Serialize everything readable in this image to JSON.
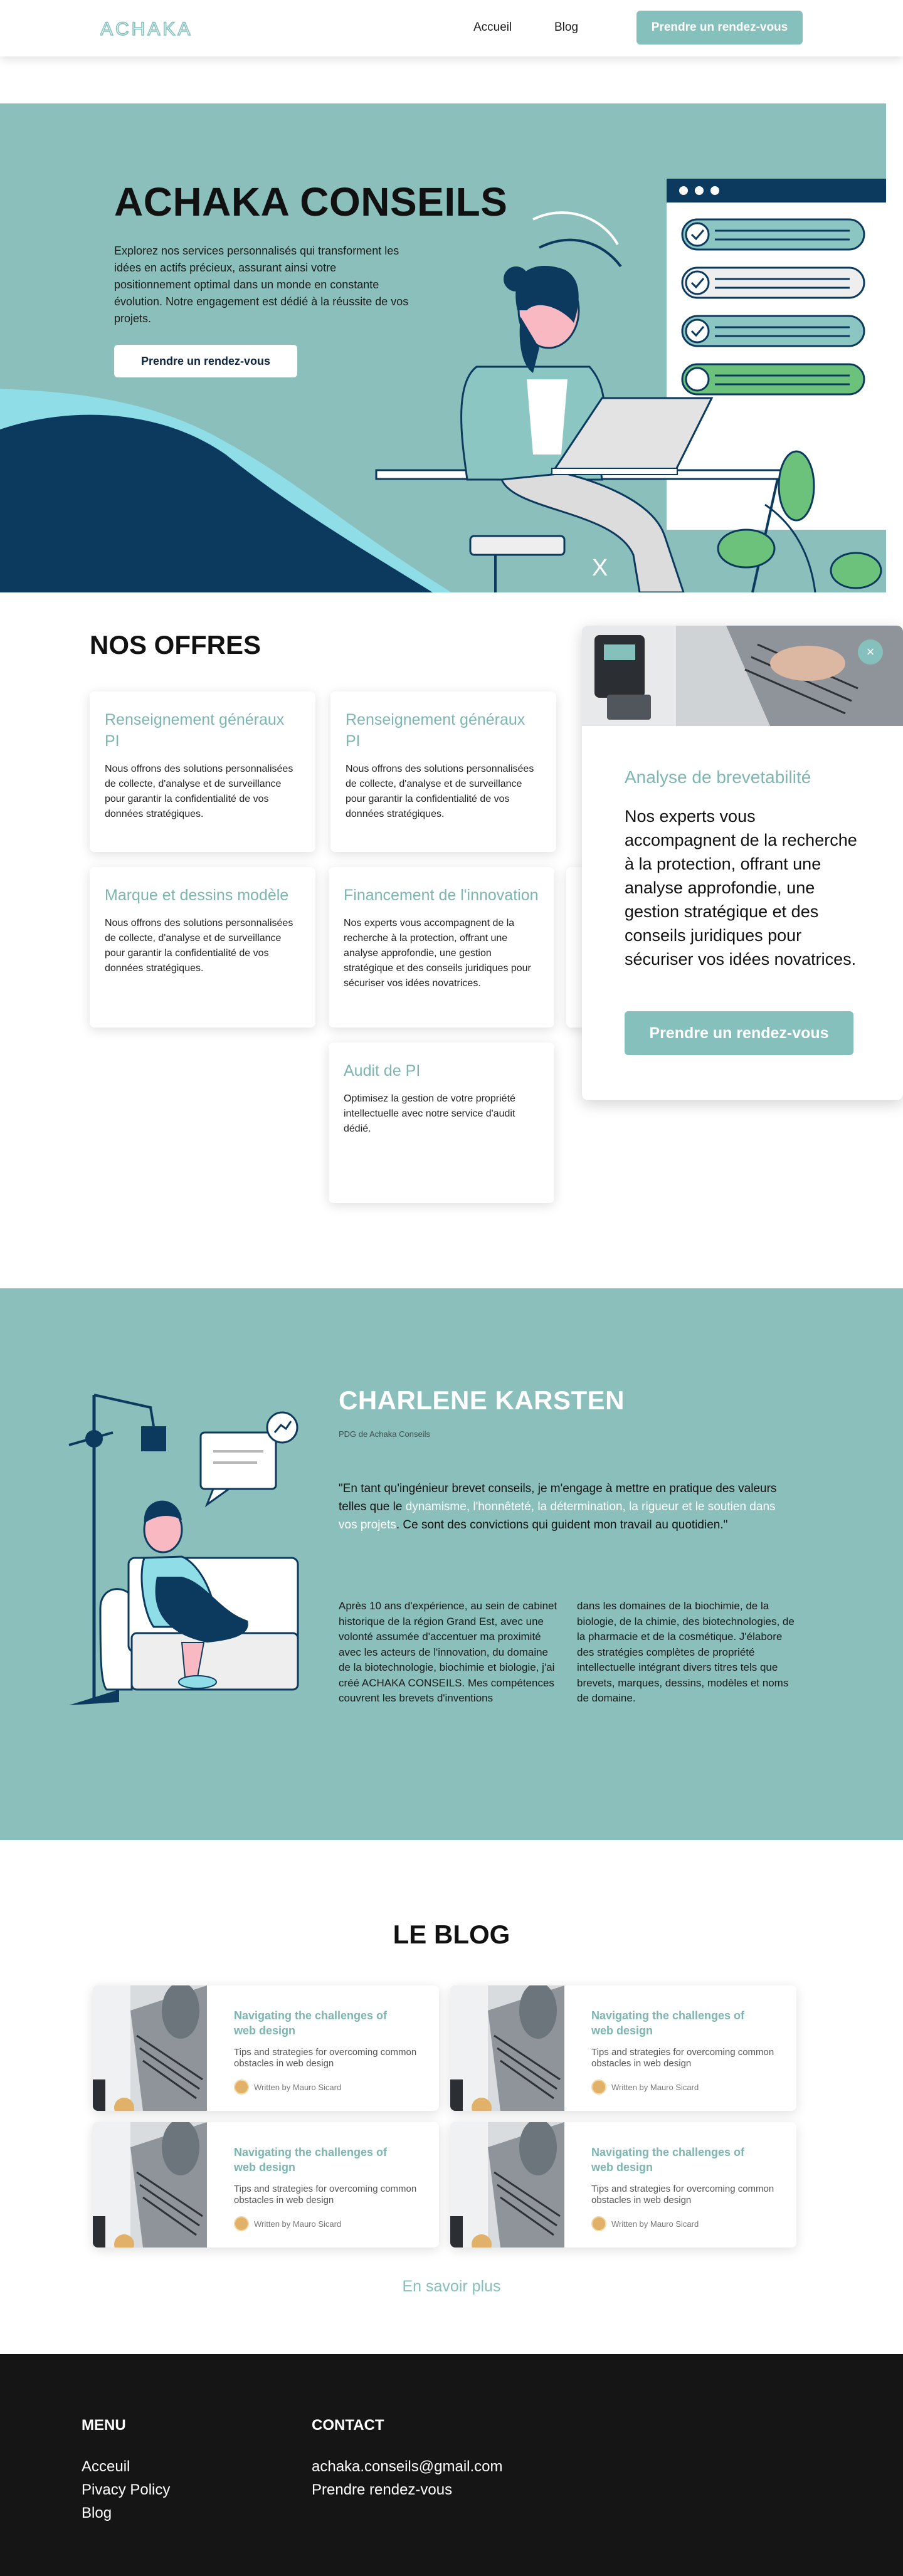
{
  "header": {
    "logo_text": "ACHAKA",
    "nav": [
      "Accueil",
      "Blog"
    ],
    "cta": "Prendre un rendez-vous"
  },
  "hero": {
    "title": "ACHAKA CONSEILS",
    "text": "Explorez nos services personnalisés qui transforment les idées en actifs précieux, assurant ainsi votre positionnement optimal dans un monde en constante évolution. Notre engagement est dédié à la réussite de vos projets.",
    "button": "Prendre un rendez-vous",
    "close_glyph": "X"
  },
  "offers": {
    "title": "NOS OFFRES",
    "cards": [
      {
        "title": "Renseignement généraux PI",
        "text": "Nous offrons des solutions personnalisées de collecte, d'analyse et de surveillance pour garantir la confidentialité de vos données stratégiques."
      },
      {
        "title": "Renseignement généraux PI",
        "text": "Nous offrons des solutions personnalisées de collecte, d'analyse et de surveillance pour garantir la confidentialité de vos données stratégiques."
      },
      {
        "title": "Marque et dessins modèle",
        "text": "Nous offrons des solutions personnalisées de collecte, d'analyse et de surveillance pour garantir la confidentialité de vos données stratégiques."
      },
      {
        "title": "Financement de l'innovation",
        "text": "Nos experts vous accompagnent de la recherche à la protection, offrant une analyse approfondie, une gestion stratégique et des conseils juridiques pour sécuriser vos idées novatrices."
      },
      {
        "title": "Audit de PI",
        "text": "Optimisez la gestion de votre propriété intellectuelle avec notre service d'audit dédié."
      }
    ]
  },
  "popup": {
    "close_glyph": "×",
    "title": "Analyse de brevetabilité",
    "text": "Nos experts vous accompagnent de la recherche à la protection, offrant une analyse approfondie, une gestion stratégique et des conseils juridiques pour sécuriser vos idées novatrices.",
    "button": "Prendre un rendez-vous"
  },
  "founder": {
    "name": "CHARLENE KARSTEN",
    "role": "PDG de Achaka Conseils",
    "quote_start": "\"En tant qu'ingénieur brevet conseils, je m'engage à mettre en pratique des valeurs telles que le ",
    "quote_values_1": "dynamisme, l'honnêteté, la détermination,",
    "quote_mid": "  ",
    "quote_values_2": "la rigueur et le soutien dans vos projets",
    "quote_end": ". Ce sont des convictions qui guident mon travail au quotidien.\"",
    "col_left": "Après 10 ans d'expérience, au sein de cabinet historique de la région Grand Est, avec une volonté assumée d'accentuer ma proximité avec les acteurs de l'innovation, du domaine de la biotechnologie, biochimie et biologie, j'ai créé ACHAKA CONSEILS. Mes compétences couvrent les brevets d'inventions",
    "col_right": "dans les domaines de la biochimie, de la biologie, de la chimie, des biotechnologies, de la pharmacie et de la cosmétique. J'élabore des stratégies complètes de propriété intellectuelle intégrant divers titres tels que brevets, marques, dessins, modèles et noms de domaine."
  },
  "blog": {
    "title": "LE BLOG",
    "posts": [
      {
        "title": "Navigating the challenges of web design",
        "desc": "Tips and strategies for overcoming common obstacles in web design",
        "author": "Written by Mauro Sicard"
      },
      {
        "title": "Navigating the challenges of web design",
        "desc": "Tips and strategies for overcoming common obstacles in web design",
        "author": "Written by Mauro Sicard"
      },
      {
        "title": "Navigating the challenges of web design",
        "desc": "Tips and strategies for overcoming common obstacles in web design",
        "author": "Written by Mauro Sicard"
      },
      {
        "title": "Navigating the challenges of web design",
        "desc": "Tips and strategies for overcoming common obstacles in web design",
        "author": "Written by Mauro Sicard"
      }
    ],
    "more": "En savoir plus"
  },
  "footer": {
    "menu_title": "MENU",
    "menu": [
      "Acceuil",
      "Pivacy Policy",
      "Blog"
    ],
    "contact_title": "CONTACT",
    "contact": [
      "achaka.conseils@gmail.com",
      "Prendre rendez-vous"
    ]
  },
  "colors": {
    "accent": "#86c0bc",
    "hero_bg": "#8bbfbb",
    "navy": "#0c3a5e",
    "footer_bg": "#151515"
  },
  "icons": [
    "x-icon",
    "close-icon",
    "chart-icon",
    "check-icon"
  ]
}
